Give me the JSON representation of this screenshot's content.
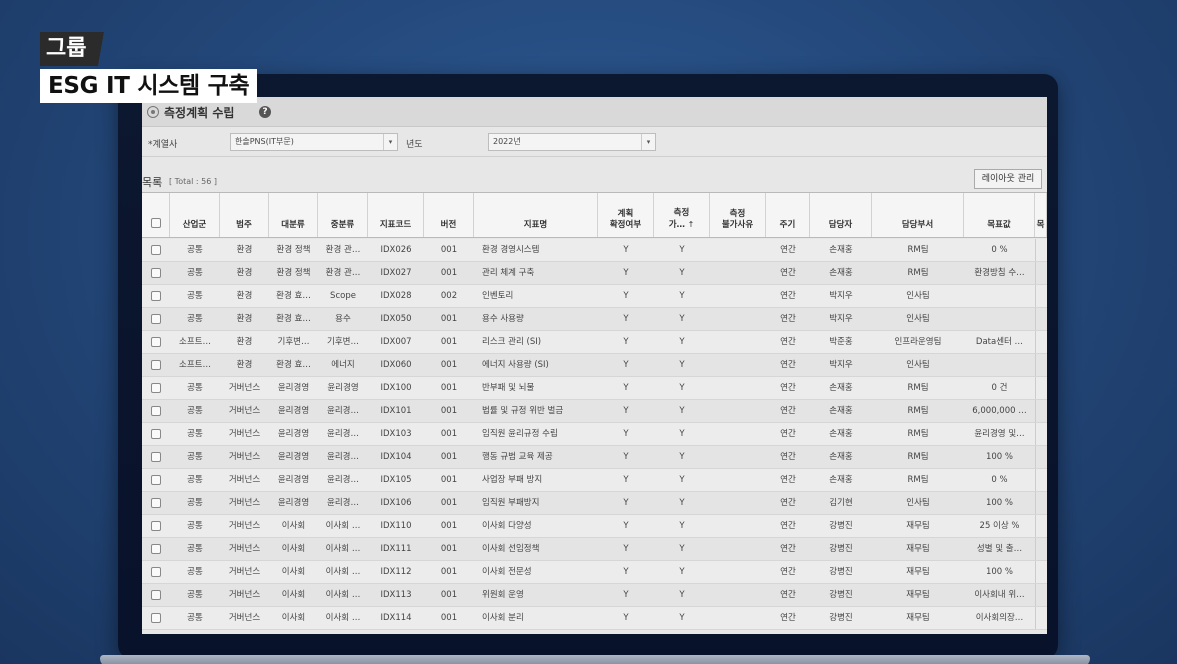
{
  "overlay": {
    "tag_small": "그룹",
    "tag_big": "ESG IT 시스템 구축"
  },
  "page": {
    "title": "측정계획 수립",
    "help_icon": "help-icon"
  },
  "filters": {
    "company_label": "*계열사",
    "company_value": "한솔PNS(IT부문)",
    "year_label": "년도",
    "year_value": "2022년"
  },
  "list": {
    "title": "목록",
    "total": "[ Total : 56 ]",
    "layout_button": "레이아웃 관리"
  },
  "table": {
    "headers": [
      "",
      "산업군",
      "범주",
      "대분류",
      "중분류",
      "지표코드",
      "버전",
      "지표명",
      "계획\n확정여부",
      "측정\n가…",
      "측정\n불가사유",
      "주기",
      "담당자",
      "담당부서",
      "목표값",
      "목"
    ],
    "rows": [
      [
        "공통",
        "환경",
        "환경 정책",
        "환경 관…",
        "IDX026",
        "001",
        "환경 경영시스템",
        "Y",
        "Y",
        "",
        "연간",
        "손재홍",
        "RM팀",
        "0 %"
      ],
      [
        "공통",
        "환경",
        "환경 정책",
        "환경 관…",
        "IDX027",
        "001",
        "관리 체계 구축",
        "Y",
        "Y",
        "",
        "연간",
        "손재홍",
        "RM팀",
        "환경방침 수…"
      ],
      [
        "공통",
        "환경",
        "환경 효…",
        "Scope",
        "IDX028",
        "002",
        "인벤토리",
        "Y",
        "Y",
        "",
        "연간",
        "박지우",
        "인사팀",
        ""
      ],
      [
        "공통",
        "환경",
        "환경 효…",
        "용수",
        "IDX050",
        "001",
        "용수 사용량",
        "Y",
        "Y",
        "",
        "연간",
        "박지우",
        "인사팀",
        ""
      ],
      [
        "소프트…",
        "환경",
        "기후변…",
        "기후변…",
        "IDX007",
        "001",
        "리스크 관리 (SI)",
        "Y",
        "Y",
        "",
        "연간",
        "박준홍",
        "인프라운영팀",
        "Data센터 …"
      ],
      [
        "소프트…",
        "환경",
        "환경 효…",
        "에너지",
        "IDX060",
        "001",
        "에너지 사용량 (SI)",
        "Y",
        "Y",
        "",
        "연간",
        "박지우",
        "인사팀",
        ""
      ],
      [
        "공통",
        "거버넌스",
        "윤리경영",
        "윤리경영",
        "IDX100",
        "001",
        "반부패 및 뇌물",
        "Y",
        "Y",
        "",
        "연간",
        "손재홍",
        "RM팀",
        "0 건"
      ],
      [
        "공통",
        "거버넌스",
        "윤리경영",
        "윤리경…",
        "IDX101",
        "001",
        "법률 및 규정 위반 벌금",
        "Y",
        "Y",
        "",
        "연간",
        "손재홍",
        "RM팀",
        "6,000,000 …"
      ],
      [
        "공통",
        "거버넌스",
        "윤리경영",
        "윤리경…",
        "IDX103",
        "001",
        "임직원 윤리규정 수립",
        "Y",
        "Y",
        "",
        "연간",
        "손재홍",
        "RM팀",
        "윤리경영 및…"
      ],
      [
        "공통",
        "거버넌스",
        "윤리경영",
        "윤리경…",
        "IDX104",
        "001",
        "행동 규범 교육 제공",
        "Y",
        "Y",
        "",
        "연간",
        "손재홍",
        "RM팀",
        "100 %"
      ],
      [
        "공통",
        "거버넌스",
        "윤리경영",
        "윤리경…",
        "IDX105",
        "001",
        "사업장 부패 방지",
        "Y",
        "Y",
        "",
        "연간",
        "손재홍",
        "RM팀",
        "0 %"
      ],
      [
        "공통",
        "거버넌스",
        "윤리경영",
        "윤리경…",
        "IDX106",
        "001",
        "임직원 부패방지",
        "Y",
        "Y",
        "",
        "연간",
        "김기현",
        "인사팀",
        "100 %"
      ],
      [
        "공통",
        "거버넌스",
        "이사회",
        "이사회 …",
        "IDX110",
        "001",
        "이사회 다양성",
        "Y",
        "Y",
        "",
        "연간",
        "강병진",
        "재무팀",
        "25 이상 %"
      ],
      [
        "공통",
        "거버넌스",
        "이사회",
        "이사회 …",
        "IDX111",
        "001",
        "이사회 선임정책",
        "Y",
        "Y",
        "",
        "연간",
        "강병진",
        "재무팀",
        "성별 및 출…"
      ],
      [
        "공통",
        "거버넌스",
        "이사회",
        "이사회 …",
        "IDX112",
        "001",
        "이사회 전문성",
        "Y",
        "Y",
        "",
        "연간",
        "강병진",
        "재무팀",
        "100 %"
      ],
      [
        "공통",
        "거버넌스",
        "이사회",
        "이사회 …",
        "IDX113",
        "001",
        "위원회 운영",
        "Y",
        "Y",
        "",
        "연간",
        "강병진",
        "재무팀",
        "이사회내 위…"
      ],
      [
        "공통",
        "거버넌스",
        "이사회",
        "이사회 …",
        "IDX114",
        "001",
        "이사회 분리",
        "Y",
        "Y",
        "",
        "연간",
        "강병진",
        "재무팀",
        "이사회의장…"
      ]
    ]
  },
  "colors": {
    "background": "#24497c",
    "screen": "#e7e7e7",
    "caption_dark": "#2b2b2b"
  }
}
